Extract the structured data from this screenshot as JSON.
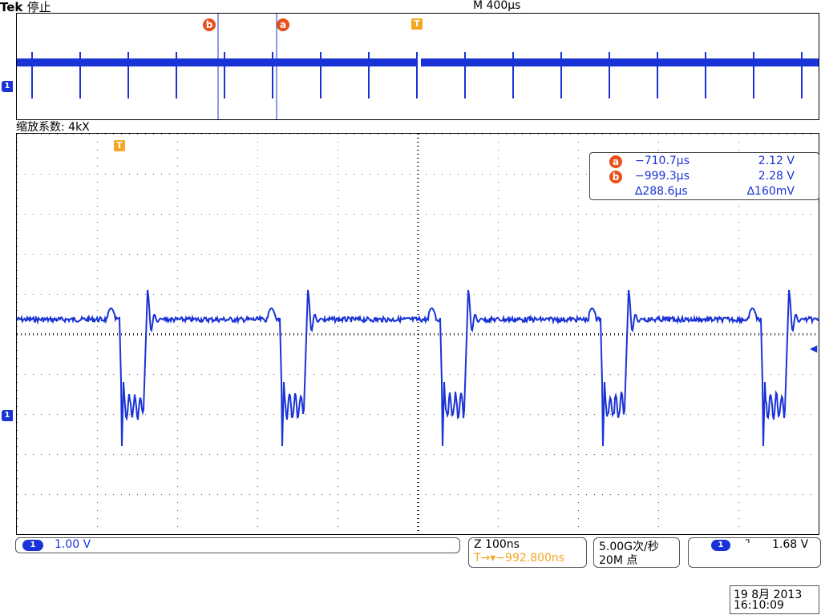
{
  "header": {
    "brand": "Tek",
    "state": "停止",
    "timebase": "M 400μs"
  },
  "overview": {
    "marker_b": "b",
    "marker_a": "a",
    "trigger_marker": "T",
    "channel_marker": "1"
  },
  "zoom_factor_label": "缩放系数: 4kX",
  "main": {
    "trigger_marker": "T",
    "channel_marker": "1"
  },
  "cursor_readout": {
    "a_marker": "a",
    "a_time": "−710.7μs",
    "a_volt": "2.12 V",
    "b_marker": "b",
    "b_time": "−999.3μs",
    "b_volt": "2.28 V",
    "delta_time": "∆288.6μs",
    "delta_volt": "∆160mV"
  },
  "channel": {
    "badge": "1",
    "scale": "1.00 V"
  },
  "zoom": {
    "timebase": "Z 100ns",
    "position": "T→▾−992.800ns"
  },
  "acquisition": {
    "sample_rate": "5.00G次/秒",
    "record_length": "20M 点"
  },
  "trigger": {
    "badge": "1",
    "slope": "⌝",
    "level": "1.68 V"
  },
  "datetime": {
    "date": "19 8月  2013",
    "time": "16:10:09"
  },
  "colors": {
    "trace": "#1a33d6",
    "cursor_marker": "#e8501a",
    "trigger_marker": "#f5a623"
  }
}
